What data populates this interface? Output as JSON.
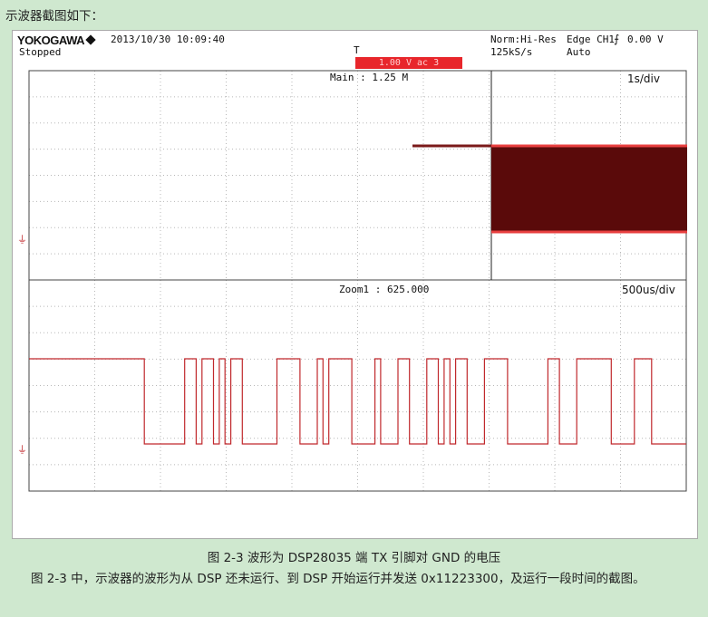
{
  "intro_text": "示波器截图如下：",
  "scope": {
    "brand": "YOKOGAWA",
    "status": "Stopped",
    "datetime": "2013/10/30 10:09:40",
    "acq_mode": "Norm:Hi-Res",
    "sample_rate": "125kS/s",
    "trigger_type": "Edge CH1",
    "trigger_level": "0.00 V",
    "trigger_mode": "Auto",
    "trigger_marker": "T",
    "trigger_pos_box": "1.00 V ac 3 ",
    "main_label": "Main : 1.25 M",
    "main_timebase": "1s/div",
    "zoom_label": "Zoom1 : 625.000",
    "zoom_timebase": "500us/div",
    "ground_marker": "⏚",
    "colors": {
      "trace": "#c0282c",
      "burst_fill": "#5a0a0a",
      "grid_dot": "#b8b8b8",
      "trigger_box": "#e8262b"
    },
    "zoom_waveform_levels": "1 1 1 1 1 1 1 1 1 1 1 1 1 1 1 1 1 1 1 1 0 0 0 0 0 0 0 1 1 0 1 1 0 1 0 1 1 0 0 0 0 0 0 1 1 1 1 0 0 0 1 0 1 1 1 1 0 0 0 0 1 0 0 0 1 1 0 0 0 1 1 0 1 0 1 1 0 0 0 1 1 1 1 0 0 0 0 0 0 0 1 1 0 0 0 1 1 1 1 1 1 0 0 0 0 1 1 1 0 0 0 0 0 0"
  },
  "figure_caption": "图 2-3  波形为 DSP28035 端 TX 引脚对 GND 的电压",
  "body_paragraph": "图 2-3 中，示波器的波形为从 DSP 还未运行、到 DSP 开始运行并发送 0x11223300，及运行一段时间的截图。"
}
